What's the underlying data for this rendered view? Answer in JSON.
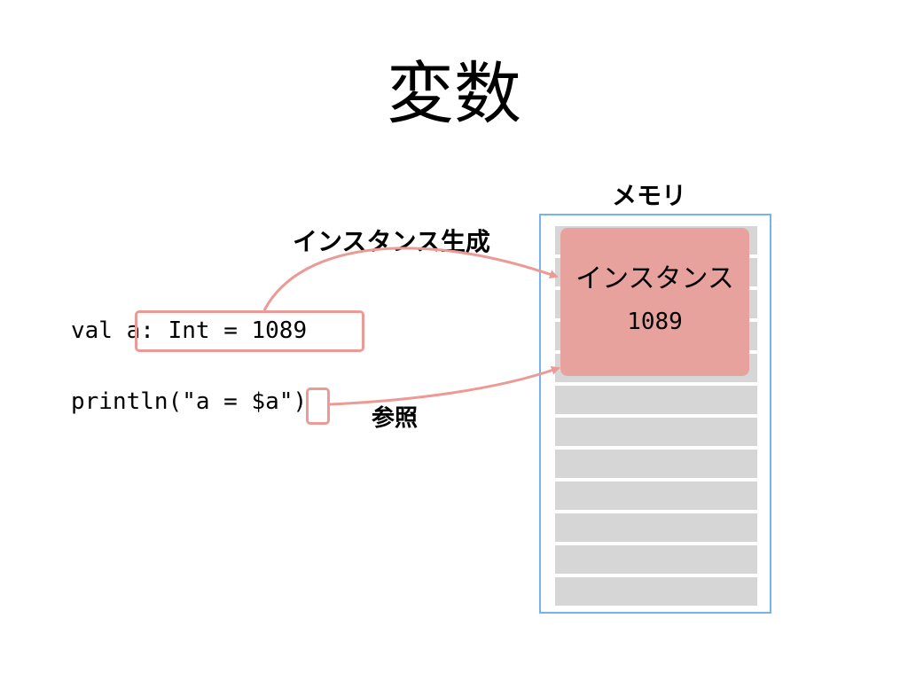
{
  "title": "変数",
  "memory": {
    "label": "メモリ",
    "cell_count": 12,
    "instance": {
      "name": "インスタンス",
      "value": "1089"
    }
  },
  "code": {
    "line1": {
      "prefix": "val ",
      "decl": "a: Int = 1089"
    },
    "line2": {
      "prefix": "println(\"a = $",
      "ref": "a",
      "suffix": "\")"
    }
  },
  "arrows": {
    "create_label": "インスタンス生成",
    "reference_label": "参照",
    "color": "#ec9a95"
  },
  "colors": {
    "highlight": "#ec9a95",
    "instance_fill": "#e8a29d",
    "memory_border": "#74b4ea",
    "memory_cell": "#d6d6d6"
  }
}
